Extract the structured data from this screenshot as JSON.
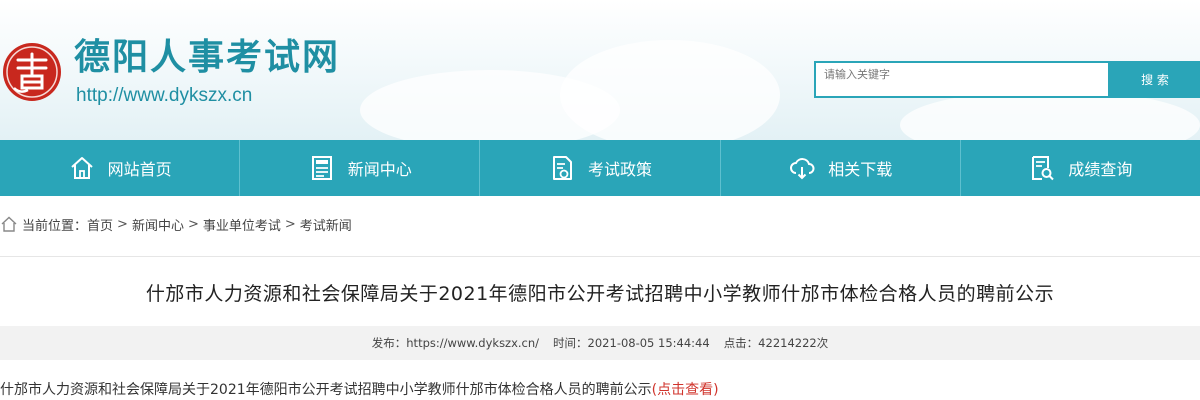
{
  "header": {
    "site_name": "德阳人事考试网",
    "site_url": "http://www.dykszx.cn",
    "logo_icon": "seal-logo-icon",
    "brand_color": "#1f8fa3",
    "seal_color": "#c8281e"
  },
  "search": {
    "placeholder": "请输入关键字",
    "button_label": "搜 索"
  },
  "nav": {
    "accent": "#2aa5b8",
    "items": [
      {
        "label": "网站首页",
        "icon": "home-icon"
      },
      {
        "label": "新闻中心",
        "icon": "news-icon"
      },
      {
        "label": "考试政策",
        "icon": "policy-document-icon"
      },
      {
        "label": "相关下载",
        "icon": "cloud-download-icon"
      },
      {
        "label": "成绩查询",
        "icon": "search-document-icon"
      }
    ]
  },
  "breadcrumb": {
    "prefix": "当前位置：",
    "items": [
      "首页",
      "新闻中心",
      "事业单位考试",
      "考试新闻"
    ],
    "separator": ">"
  },
  "article": {
    "title": "什邡市人力资源和社会保障局关于2021年德阳市公开考试招聘中小学教师什邡市体检合格人员的聘前公示",
    "meta_source": "发布：https://www.dykszx.cn/",
    "meta_time": "时间：2021-08-05 15:44:44",
    "meta_clicks": "点击：42214222次",
    "body_text": "什邡市人力资源和社会保障局关于2021年德阳市公开考试招聘中小学教师什邡市体检合格人员的聘前公示",
    "body_link": "(点击查看)",
    "link_color": "#d0342c"
  }
}
